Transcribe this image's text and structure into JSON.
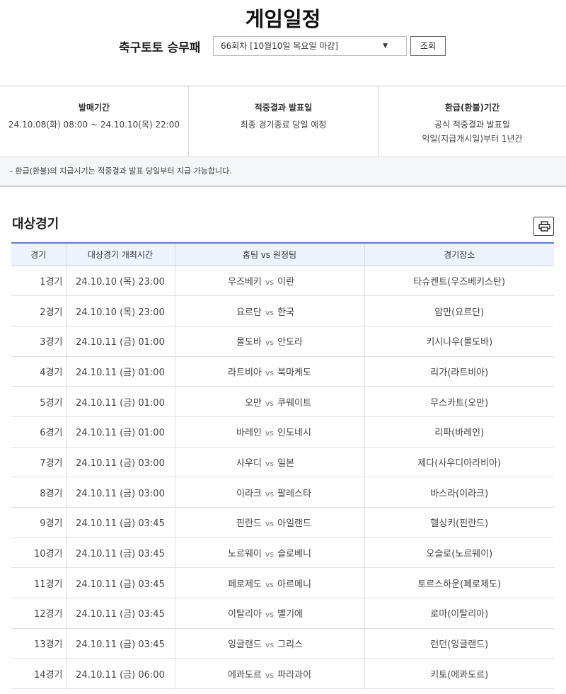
{
  "header": {
    "title": "게임일정",
    "game_label": "축구토토 승무패",
    "round_select": "66회차 [10월10일 목요일 마감]",
    "search_button": "조회"
  },
  "info": {
    "sales_title": "발매기간",
    "sales_period": "24.10.08(화) 08:00 ~ 24.10.10(목) 22:00",
    "result_title": "적중결과 발표일",
    "result_text": "최종 경기종료 당일 예정",
    "refund_title": "환급(환불)기간",
    "refund_line1": "공식 적중결과 발표일",
    "refund_line2": "익일(지급개시일)부터 1년간"
  },
  "notice": "- 환급(환불)의 지급시기는 적중결과 발표 당일부터 지급 가능합니다.",
  "section": {
    "title": "대상경기"
  },
  "table": {
    "headers": [
      "경기",
      "대상경기 개최시간",
      "홈팀 vs 원정팀",
      "경기장소"
    ],
    "vs": "vs",
    "rows": [
      {
        "no": "1경기",
        "time": "24.10.10 (목) 23:00",
        "home": "우즈베키",
        "away": "이란",
        "venue": "타슈켄트(우즈베키스탄)"
      },
      {
        "no": "2경기",
        "time": "24.10.10 (목) 23:00",
        "home": "요르단",
        "away": "한국",
        "venue": "암만(요르단)"
      },
      {
        "no": "3경기",
        "time": "24.10.11 (금) 01:00",
        "home": "몰도바",
        "away": "안도라",
        "venue": "키시나우(몰도바)"
      },
      {
        "no": "4경기",
        "time": "24.10.11 (금) 01:00",
        "home": "라트비아",
        "away": "북마케도",
        "venue": "리가(라트비아)"
      },
      {
        "no": "5경기",
        "time": "24.10.11 (금) 01:00",
        "home": "오만",
        "away": "쿠웨이트",
        "venue": "무스카트(오만)"
      },
      {
        "no": "6경기",
        "time": "24.10.11 (금) 01:00",
        "home": "바레인",
        "away": "인도네시",
        "venue": "리파(바레인)"
      },
      {
        "no": "7경기",
        "time": "24.10.11 (금) 03:00",
        "home": "사우디",
        "away": "일본",
        "venue": "제다(사우디아라비아)"
      },
      {
        "no": "8경기",
        "time": "24.10.11 (금) 03:00",
        "home": "이라크",
        "away": "팔레스타",
        "venue": "바스라(이라크)"
      },
      {
        "no": "9경기",
        "time": "24.10.11 (금) 03:45",
        "home": "핀란드",
        "away": "아일랜드",
        "venue": "헬싱키(핀란드)"
      },
      {
        "no": "10경기",
        "time": "24.10.11 (금) 03:45",
        "home": "노르웨이",
        "away": "슬로베니",
        "venue": "오슬로(노르웨이)"
      },
      {
        "no": "11경기",
        "time": "24.10.11 (금) 03:45",
        "home": "페로제도",
        "away": "아르메니",
        "venue": "토르스하운(페로제도)"
      },
      {
        "no": "12경기",
        "time": "24.10.11 (금) 03:45",
        "home": "이탈리아",
        "away": "벨기에",
        "venue": "로마(이탈리아)"
      },
      {
        "no": "13경기",
        "time": "24.10.11 (금) 03:45",
        "home": "잉글랜드",
        "away": "그리스",
        "venue": "런던(잉글랜드)"
      },
      {
        "no": "14경기",
        "time": "24.10.11 (금) 06:00",
        "home": "에콰도르",
        "away": "파라과이",
        "venue": "키토(에콰도르)"
      }
    ]
  }
}
